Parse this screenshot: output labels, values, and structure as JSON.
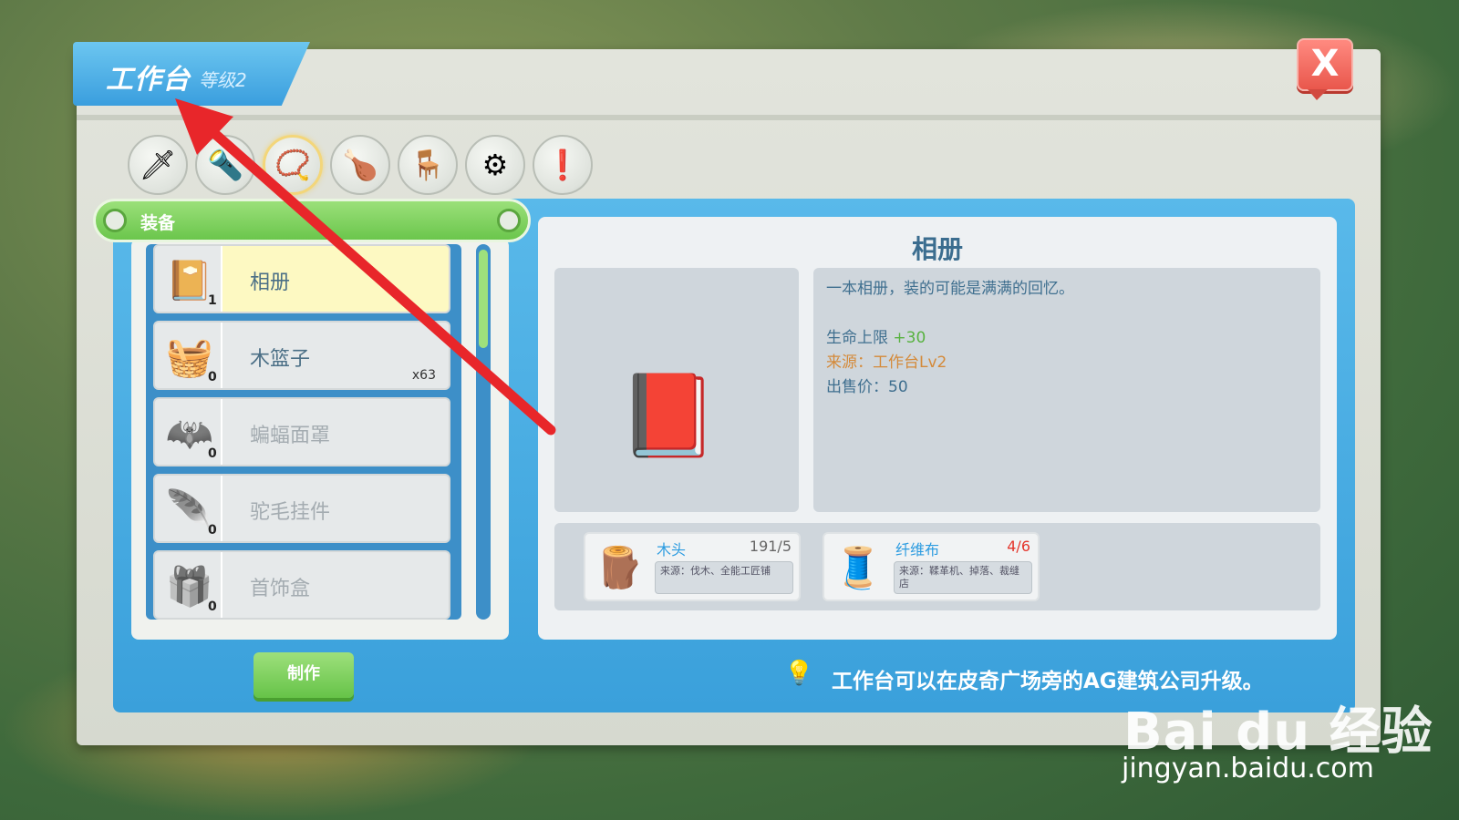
{
  "window": {
    "title": "工作台",
    "level": "等级2",
    "close_label": "X"
  },
  "categories": [
    {
      "icon": "sword-icon",
      "glyph": "🗡"
    },
    {
      "icon": "torch-icon",
      "glyph": "🔦"
    },
    {
      "icon": "necklace-icon",
      "glyph": "📿",
      "active": true
    },
    {
      "icon": "meat-icon",
      "glyph": "🍗"
    },
    {
      "icon": "chair-icon",
      "glyph": "🪑"
    },
    {
      "icon": "gear-icon",
      "glyph": "⚙"
    },
    {
      "icon": "exclamation-icon",
      "glyph": "❗"
    }
  ],
  "list": {
    "header": "装备",
    "items": [
      {
        "name": "相册",
        "count": "1",
        "stock": "",
        "glyph": "📔",
        "selected": true,
        "available": true
      },
      {
        "name": "木篮子",
        "count": "0",
        "stock": "x63",
        "glyph": "🧺",
        "selected": false,
        "available": true
      },
      {
        "name": "蝙蝠面罩",
        "count": "0",
        "stock": "",
        "glyph": "🦇",
        "selected": false,
        "available": false
      },
      {
        "name": "驼毛挂件",
        "count": "0",
        "stock": "",
        "glyph": "🪶",
        "selected": false,
        "available": false
      },
      {
        "name": "首饰盒",
        "count": "0",
        "stock": "",
        "glyph": "🎁",
        "selected": false,
        "available": false
      }
    ]
  },
  "make_button": "制作",
  "detail": {
    "title": "相册",
    "description": "一本相册，装的可能是满满的回忆。",
    "hp_label": "生命上限",
    "hp_value": "+30",
    "source": "来源：工作台Lv2",
    "price": "出售价：50",
    "preview_glyph": "📕"
  },
  "materials": [
    {
      "name": "木头",
      "qty": "191/5",
      "source": "来源：伐木、全能工匠铺",
      "glyph": "🪵",
      "short": false
    },
    {
      "name": "纤维布",
      "qty": "4/6",
      "source": "来源：鞣革机、掉落、裁缝店",
      "glyph": "🧵",
      "short": true
    }
  ],
  "tip": "工作台可以在皮奇广场旁的AG建筑公司升级。",
  "watermark": {
    "logo": "Bai du 经验",
    "url": "jingyan.baidu.com"
  }
}
